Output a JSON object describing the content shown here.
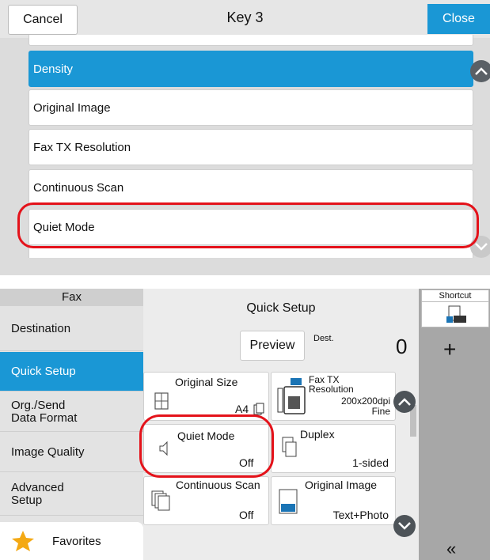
{
  "top": {
    "cancel_label": "Cancel",
    "title": "Key 3",
    "close_label": "Close",
    "items": [
      "Density",
      "Original Image",
      "Fax TX Resolution",
      "Continuous Scan",
      "Quiet Mode"
    ],
    "selected_item": "Density"
  },
  "bottom": {
    "nav_header": "Fax",
    "nav": [
      "Destination",
      "Quick Setup",
      "Org./Send\nData Format",
      "Image Quality",
      "Advanced\nSetup"
    ],
    "favorites": "Favorites",
    "section_title": "Quick Setup",
    "preview_label": "Preview",
    "dest_label": "Dest.",
    "dest_count": "0",
    "tiles": {
      "original_size": {
        "label": "Original Size",
        "value": "A4"
      },
      "fax_tx_resolution": {
        "label": "Fax TX\nResolution",
        "value": "200x200dpi\nFine",
        "icon_text": "dpi"
      },
      "quiet_mode": {
        "label": "Quiet Mode",
        "value": "Off"
      },
      "duplex": {
        "label": "Duplex",
        "value": "1-sided"
      },
      "continuous_scan": {
        "label": "Continuous Scan",
        "value": "Off"
      },
      "original_image": {
        "label": "Original Image",
        "value": "Text+Photo",
        "icon_text": "ABC\nDEF"
      }
    },
    "shortcut_label": "Shortcut",
    "shortcut_icon_text": "AME",
    "add_label": "+",
    "collapse_label": "«"
  },
  "colors": {
    "accent": "#1a97d5",
    "highlight": "#e4121a"
  }
}
